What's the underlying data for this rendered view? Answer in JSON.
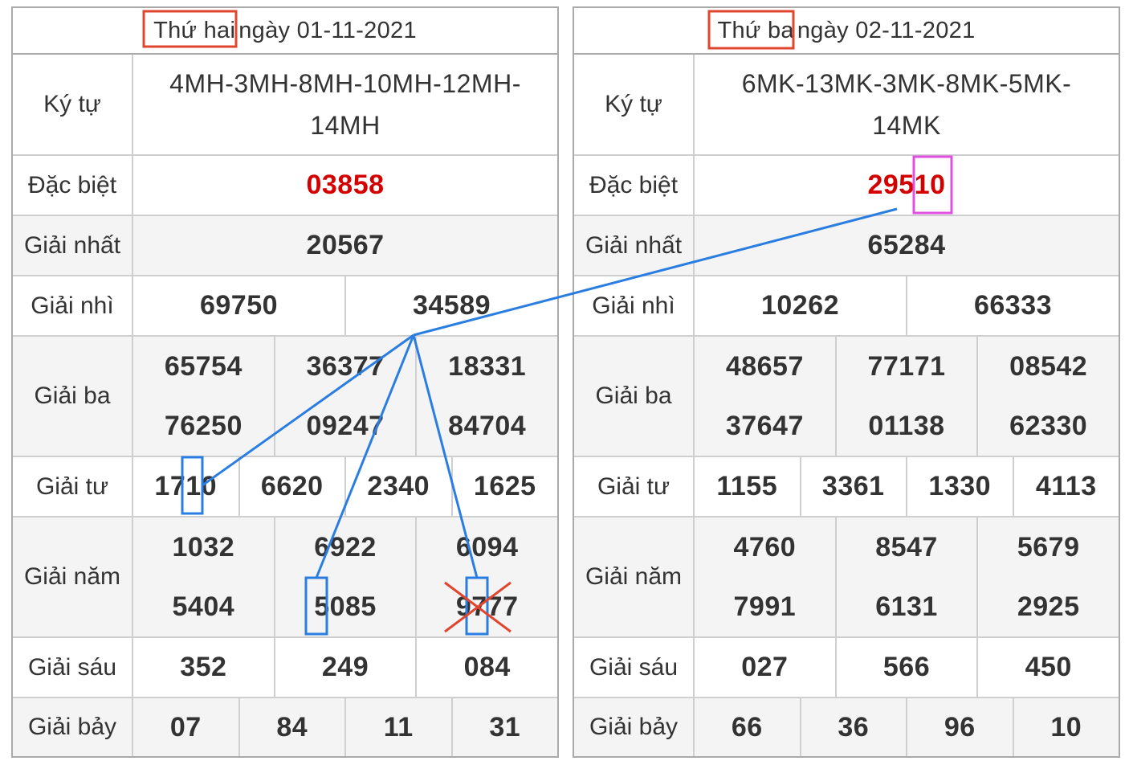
{
  "left": {
    "day": "Thứ hai",
    "date_rest": "ngày 01-11-2021",
    "labels": {
      "kytu": "Ký tự",
      "db": "Đặc biệt",
      "g1": "Giải nhất",
      "g2": "Giải nhì",
      "g3": "Giải ba",
      "g4": "Giải tư",
      "g5": "Giải năm",
      "g6": "Giải sáu",
      "g7": "Giải bảy"
    },
    "kytu_line1": "4MH-3MH-8MH-10MH-12MH-",
    "kytu_line2": "14MH",
    "db": "03858",
    "g1": "20567",
    "g2": [
      "69750",
      "34589"
    ],
    "g3": [
      "65754",
      "36377",
      "18331",
      "76250",
      "09247",
      "84704"
    ],
    "g4": [
      "1710",
      "6620",
      "2340",
      "1625"
    ],
    "g5": [
      "1032",
      "6922",
      "6094",
      "5404",
      "5085",
      "9777"
    ],
    "g6": [
      "352",
      "249",
      "084"
    ],
    "g7": [
      "07",
      "84",
      "11",
      "31"
    ]
  },
  "right": {
    "day": "Thứ ba",
    "date_rest": "ngày 02-11-2021",
    "labels": {
      "kytu": "Ký tự",
      "db": "Đặc biệt",
      "g1": "Giải nhất",
      "g2": "Giải nhì",
      "g3": "Giải ba",
      "g4": "Giải tư",
      "g5": "Giải năm",
      "g6": "Giải sáu",
      "g7": "Giải bảy"
    },
    "kytu_line1": "6MK-13MK-3MK-8MK-5MK-",
    "kytu_line2": "14MK",
    "db": "29510",
    "g1": "65284",
    "g2": [
      "10262",
      "66333"
    ],
    "g3": [
      "48657",
      "77171",
      "08542",
      "37647",
      "01138",
      "62330"
    ],
    "g4": [
      "1155",
      "3361",
      "1330",
      "4113"
    ],
    "g5": [
      "4760",
      "8547",
      "5679",
      "7991",
      "6131",
      "2925"
    ],
    "g6": [
      "027",
      "566",
      "450"
    ],
    "g7": [
      "66",
      "36",
      "96",
      "10"
    ]
  },
  "annotation_colors": {
    "date_box": "#e0452e",
    "highlight_box": "#2a7de1",
    "special_box": "#e04fe0",
    "cross": "#e0452e",
    "line": "#2a7de1"
  }
}
